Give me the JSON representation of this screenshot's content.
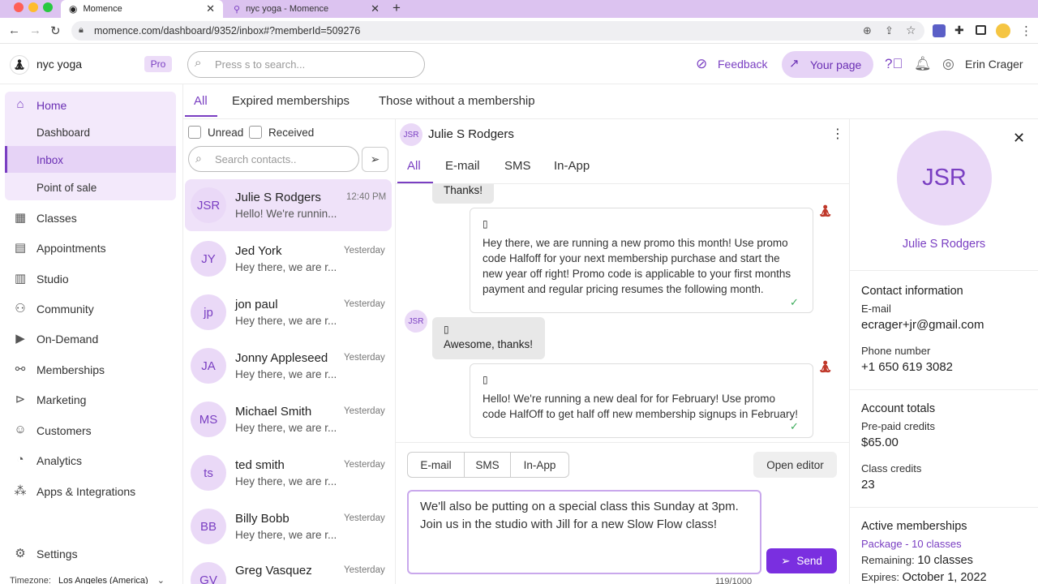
{
  "browser": {
    "tabs": [
      {
        "title": "Momence"
      },
      {
        "title": "nyc yoga - Momence"
      }
    ],
    "url": "momence.com/dashboard/9352/inbox#?memberId=509276"
  },
  "header": {
    "org_name": "nyc yoga",
    "plan_badge": "Pro",
    "search_placeholder": "Press s to search...",
    "feedback_label": "Feedback",
    "your_page_label": "Your page",
    "user_name": "Erin Crager"
  },
  "sidebar": {
    "home": "Home",
    "home_sub": [
      "Dashboard",
      "Inbox",
      "Point of sale"
    ],
    "items": [
      "Classes",
      "Appointments",
      "Studio",
      "Community",
      "On-Demand",
      "Memberships",
      "Marketing",
      "Customers",
      "Analytics",
      "Apps & Integrations"
    ],
    "settings": "Settings",
    "timezone_label": "Timezone:",
    "timezone_value": "Los Angeles (America)"
  },
  "filters": {
    "tabs": [
      "All",
      "Expired memberships",
      "Those without a membership"
    ],
    "active": "All"
  },
  "contacts": {
    "unread_label": "Unread",
    "received_label": "Received",
    "search_placeholder": "Search contacts..",
    "list": [
      {
        "initials": "JSR",
        "name": "Julie S Rodgers",
        "time": "12:40 PM",
        "preview": "Hello! We're runnin..."
      },
      {
        "initials": "JY",
        "name": "Jed York",
        "time": "Yesterday",
        "preview": "Hey there, we are r..."
      },
      {
        "initials": "jp",
        "name": "jon paul",
        "time": "Yesterday",
        "preview": "Hey there, we are r..."
      },
      {
        "initials": "JA",
        "name": "Jonny Appleseed",
        "time": "Yesterday",
        "preview": "Hey there, we are r..."
      },
      {
        "initials": "MS",
        "name": "Michael Smith",
        "time": "Yesterday",
        "preview": "Hey there, we are r..."
      },
      {
        "initials": "ts",
        "name": "ted smith",
        "time": "Yesterday",
        "preview": "Hey there, we are r..."
      },
      {
        "initials": "BB",
        "name": "Billy Bobb",
        "time": "Yesterday",
        "preview": "Hey there, we are r..."
      },
      {
        "initials": "GV",
        "name": "Greg Vasquez",
        "time": "Yesterday",
        "preview": ""
      }
    ]
  },
  "conversation": {
    "initials": "JSR",
    "name": "Julie S Rodgers",
    "tabs": [
      "All",
      "E-mail",
      "SMS",
      "In-App"
    ],
    "messages": [
      {
        "dir": "in",
        "text": "Thanks!"
      },
      {
        "dir": "out",
        "text": "Hey there, we are running a new promo this month! Use promo code Halfoff for your next membership purchase and start the new year off right! Promo code is applicable to your first months payment and regular pricing resumes the following month."
      },
      {
        "dir": "in",
        "initials": "JSR",
        "text": "Awesome, thanks!"
      },
      {
        "dir": "out",
        "text": "Hello! We're running a new deal for for February! Use promo code HalfOff to get half off new membership signups in February!"
      }
    ]
  },
  "composer": {
    "channels": [
      "E-mail",
      "SMS",
      "In-App"
    ],
    "open_editor_label": "Open editor",
    "text": "We'll also be putting on a special class this Sunday at 3pm. Join us in the studio with Jill for a new Slow Flow class!",
    "send_label": "Send",
    "counter": "119/1000"
  },
  "profile": {
    "initials": "JSR",
    "name": "Julie S Rodgers",
    "contact_heading": "Contact information",
    "email_label": "E-mail",
    "email": "ecrager+jr@gmail.com",
    "phone_label": "Phone number",
    "phone": "+1 650 619 3082",
    "totals_heading": "Account totals",
    "prepaid_label": "Pre-paid credits",
    "prepaid": "$65.00",
    "class_credits_label": "Class credits",
    "class_credits": "23",
    "memberships_heading": "Active memberships",
    "membership_name": "Package - 10 classes",
    "remaining_label": "Remaining:",
    "remaining": "10 classes",
    "expires_label": "Expires:",
    "expires": "October 1, 2022"
  },
  "colors": {
    "accent": "#7a3fc2",
    "accent_light": "#ead9f7",
    "send": "#7a2fe0"
  }
}
